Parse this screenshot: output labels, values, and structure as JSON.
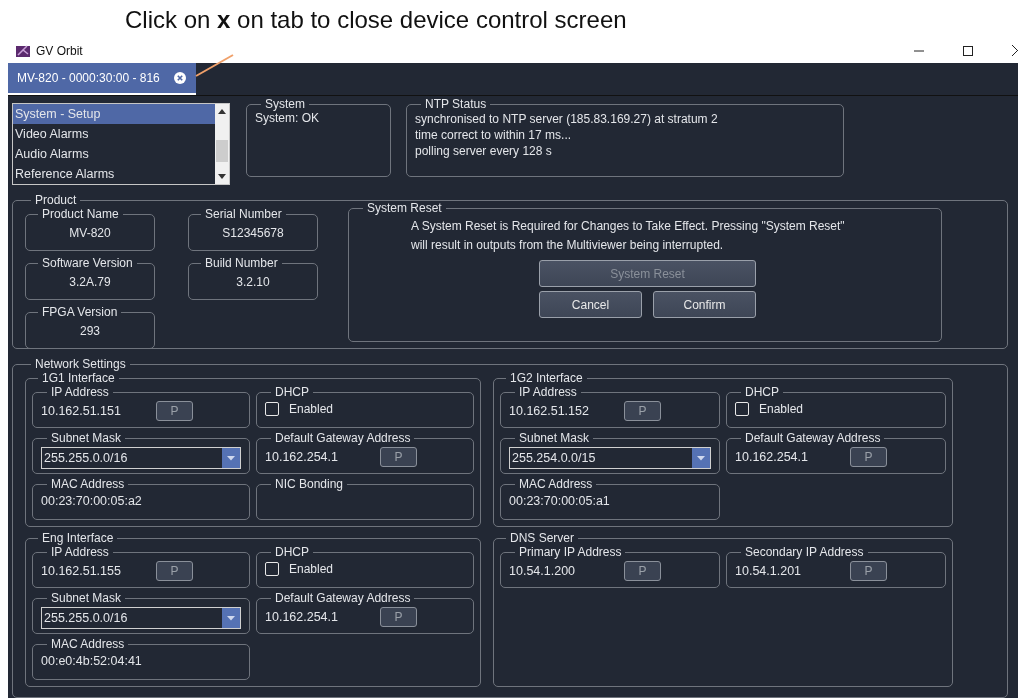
{
  "callout": {
    "text": "Click on **x** on tab to close device control screen"
  },
  "window": {
    "title": "GV Orbit"
  },
  "tabs": [
    {
      "label": "MV-820 - 0000:30:00 - 816",
      "selected": true
    }
  ],
  "nav_list": {
    "items": [
      {
        "label": "System - Setup",
        "selected": true
      },
      {
        "label": "Video Alarms",
        "selected": false
      },
      {
        "label": "Audio Alarms",
        "selected": false
      },
      {
        "label": "Reference Alarms",
        "selected": false
      }
    ]
  },
  "system": {
    "title": "System",
    "status": "System: OK"
  },
  "ntp_status": {
    "title": "NTP Status",
    "lines": [
      "synchronised to NTP server (185.83.169.27) at stratum 2",
      "time correct to within 17 ms...",
      "polling server every 128 s"
    ]
  },
  "product": {
    "title": "Product",
    "fields": [
      {
        "label": "Product Name",
        "value": "MV-820"
      },
      {
        "label": "Serial Number",
        "value": "S12345678"
      },
      {
        "label": "Software Version",
        "value": "3.2A.79"
      },
      {
        "label": "Build Number",
        "value": "3.2.10"
      },
      {
        "label": "FPGA Version",
        "value": "293"
      }
    ]
  },
  "system_reset": {
    "title": "System Reset",
    "lines": [
      "A System Reset is Required for Changes to Take Effect. Pressing \"System Reset\"",
      "will result in outputs from the Multiviewer being interrupted."
    ],
    "buttons": [
      {
        "label": "System Reset",
        "disabled": true
      },
      {
        "label": "Cancel",
        "disabled": false
      },
      {
        "label": "Confirm",
        "disabled": false
      }
    ]
  },
  "network": {
    "title": "Network Settings",
    "columns": [
      {
        "groups": [
          {
            "title": "1G1 Interface",
            "cells": [
              {
                "kind": "address",
                "label": "IP Address",
                "value": "10.162.51.151",
                "button": "P"
              },
              {
                "kind": "checkbox",
                "label": "DHCP",
                "option": "Enabled",
                "checked": false
              },
              {
                "kind": "select",
                "label": "Subnet Mask",
                "value": "255.255.0.0/16"
              },
              {
                "kind": "address",
                "label": "Default Gateway Address",
                "value": "10.162.254.1",
                "button": "P"
              },
              {
                "kind": "text",
                "label": "MAC Address",
                "value": "00:23:70:00:05:a2"
              },
              {
                "kind": "text",
                "label": "NIC Bonding"
              }
            ]
          },
          {
            "title": "Eng Interface",
            "cells": [
              {
                "kind": "address",
                "label": "IP Address",
                "value": "10.162.51.155",
                "button": "P"
              },
              {
                "kind": "checkbox",
                "label": "DHCP",
                "option": "Enabled",
                "checked": false
              },
              {
                "kind": "select",
                "label": "Subnet Mask",
                "value": "255.255.0.0/16"
              },
              {
                "kind": "address",
                "label": "Default Gateway Address",
                "value": "10.162.254.1",
                "button": "P"
              },
              {
                "kind": "text",
                "label": "MAC Address",
                "value": "00:e0:4b:52:04:41"
              }
            ]
          }
        ]
      },
      {
        "groups": [
          {
            "title": "1G2 Interface",
            "cells": [
              {
                "kind": "address",
                "label": "IP Address",
                "value": "10.162.51.152",
                "button": "P"
              },
              {
                "kind": "checkbox",
                "label": "DHCP",
                "option": "Enabled",
                "checked": false
              },
              {
                "kind": "select",
                "label": "Subnet Mask",
                "value": "255.254.0.0/15"
              },
              {
                "kind": "address",
                "label": "Default Gateway Address",
                "value": "10.162.254.1",
                "button": "P"
              },
              {
                "kind": "text",
                "label": "MAC Address",
                "value": "00:23:70:00:05:a1"
              }
            ]
          },
          {
            "title": "DNS Server",
            "cells": [
              {
                "kind": "address",
                "label": "Primary IP Address",
                "value": "10.54.1.200",
                "button": "P"
              },
              {
                "kind": "address",
                "label": "Secondary IP Address",
                "value": "10.54.1.201",
                "button": "P"
              }
            ]
          }
        ]
      }
    ]
  }
}
